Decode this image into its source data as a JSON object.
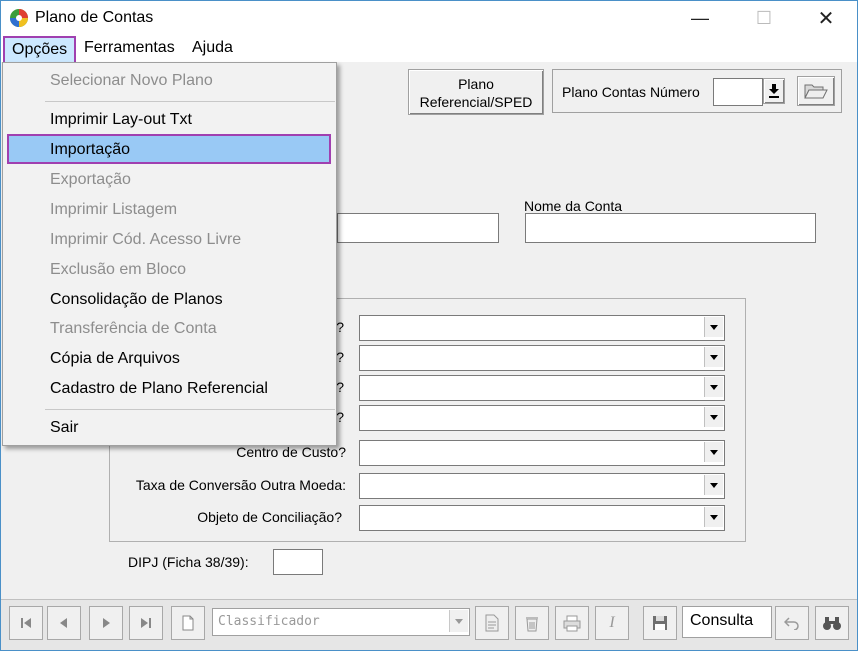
{
  "window": {
    "title": "Plano de Contas",
    "controls": {
      "minimize": "—",
      "maximize": "☐",
      "close": "✕"
    }
  },
  "menubar": {
    "items": [
      "Opções",
      "Ferramentas",
      "Ajuda"
    ]
  },
  "header": {
    "plano_referencial_line1": "Plano",
    "plano_referencial_line2": "Referencial/SPED",
    "plano_contas_numero_label": "Plano Contas Número",
    "plano_contas_numero_value": ""
  },
  "form": {
    "nome_da_conta_label": "Nome da Conta",
    "combo_labels_partial": [
      "?",
      "?",
      "?",
      "?"
    ],
    "centro_de_custo_label": "Centro de Custo?",
    "taxa_conversao_label": "Taxa de Conversão Outra Moeda:",
    "objeto_conciliacao_label": "Objeto de Conciliação?",
    "dipj_label": "DIPJ (Ficha 38/39):"
  },
  "dropdown": {
    "items": [
      {
        "label": "Selecionar Novo Plano",
        "enabled": false
      },
      {
        "label": "Imprimir Lay-out Txt",
        "enabled": true
      },
      {
        "label": "Importação",
        "enabled": true,
        "highlighted": true
      },
      {
        "label": "Exportação",
        "enabled": false
      },
      {
        "label": "Imprimir Listagem",
        "enabled": false
      },
      {
        "label": "Imprimir Cód. Acesso Livre",
        "enabled": false
      },
      {
        "label": "Exclusão em Bloco",
        "enabled": false
      },
      {
        "label": "Consolidação de Planos",
        "enabled": true
      },
      {
        "label": "Transferência de Conta",
        "enabled": false
      },
      {
        "label": "Cópia de Arquivos",
        "enabled": true
      },
      {
        "label": "Cadastro de Plano Referencial",
        "enabled": true
      },
      {
        "label": "Sair",
        "enabled": true
      }
    ]
  },
  "toolbar": {
    "classificador_value": "Classificador",
    "mode_text": "Consulta"
  },
  "colors": {
    "highlight": "#99c9f5",
    "highlight_border": "#a040b0",
    "disabled_text": "#8d8d8d"
  }
}
